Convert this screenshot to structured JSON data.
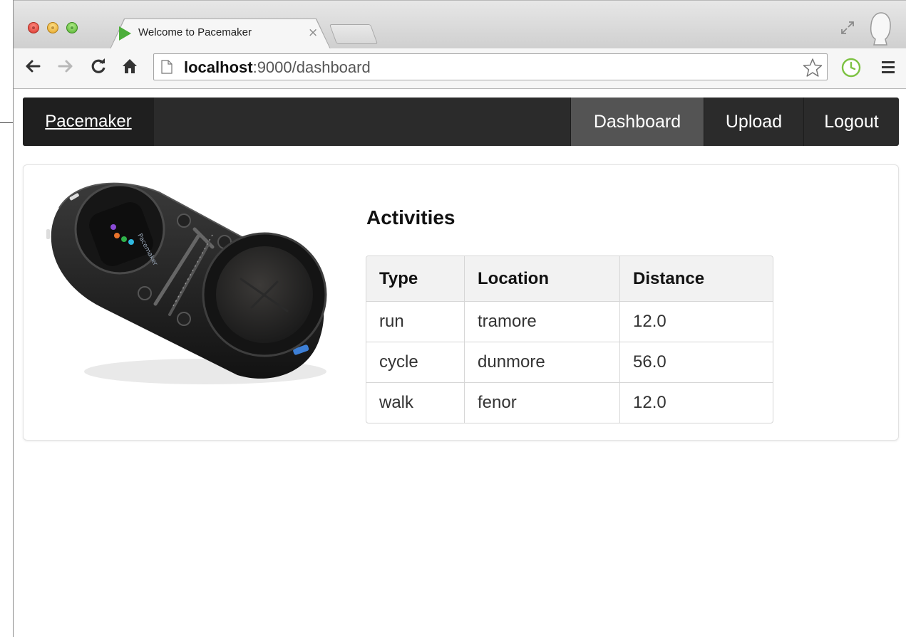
{
  "browser": {
    "tab": {
      "title": "Welcome to Pacemaker",
      "close_glyph": "×",
      "favicon": "green-play-icon"
    },
    "url": {
      "host": "localhost",
      "path": ":9000/dashboard"
    },
    "icons": [
      "back-arrow-icon",
      "forward-arrow-icon",
      "reload-icon",
      "home-icon",
      "page-icon",
      "star-icon",
      "history-clock-icon",
      "menu-icon",
      "fullscreen-icon",
      "profile-icon"
    ]
  },
  "navbar": {
    "brand": "Pacemaker",
    "items": [
      {
        "label": "Dashboard",
        "active": true
      },
      {
        "label": "Upload",
        "active": false
      },
      {
        "label": "Logout",
        "active": false
      }
    ],
    "colors": {
      "bar": "#2b2b2b",
      "active": "#545454"
    }
  },
  "main": {
    "title": "Activities",
    "table": {
      "headers": [
        "Type",
        "Location",
        "Distance"
      ],
      "rows": [
        [
          "run",
          "tramore",
          "12.0"
        ],
        [
          "cycle",
          "dunmore",
          "56.0"
        ],
        [
          "walk",
          "fenor",
          "12.0"
        ]
      ]
    },
    "device_image": "pacemaker-device-image"
  }
}
